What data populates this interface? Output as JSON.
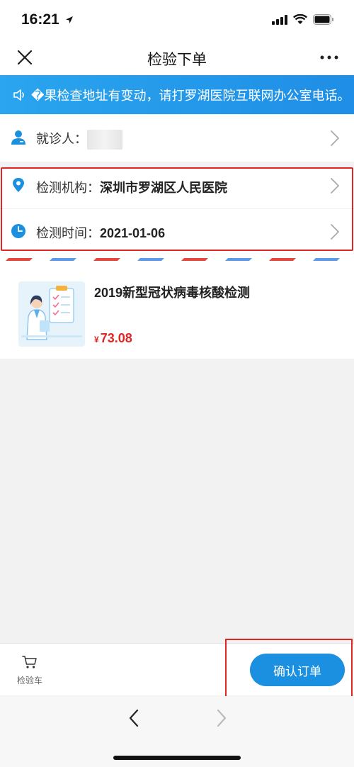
{
  "status_bar": {
    "time": "16:21"
  },
  "nav": {
    "title": "检验下单"
  },
  "notice": {
    "text": "�果检查地址有变动，请打罗湖医院互联网办公室电话。"
  },
  "patient": {
    "label": "就诊人："
  },
  "institution": {
    "label": "检测机构：",
    "value": "深圳市罗湖区人民医院"
  },
  "test_time": {
    "label": "检测时间：",
    "value": "2021-01-06"
  },
  "product": {
    "name": "2019新型冠状病毒核酸检测",
    "currency": "¥",
    "price": "73.08"
  },
  "bottom": {
    "cart_label": "检验车",
    "confirm_label": "确认订单"
  },
  "colors": {
    "accent": "#1b8fe0",
    "price": "#e02525",
    "highlight": "#e02525",
    "stripe_red": "#e8463c",
    "stripe_blue": "#5b9bea"
  },
  "icons": [
    "navigation-arrow-icon",
    "signal-icon",
    "wifi-icon",
    "battery-icon",
    "close-icon",
    "more-icon",
    "speaker-icon",
    "person-icon",
    "location-pin-icon",
    "clock-icon",
    "chevron-right-icon",
    "cart-icon",
    "back-arrow-icon",
    "forward-arrow-icon"
  ]
}
